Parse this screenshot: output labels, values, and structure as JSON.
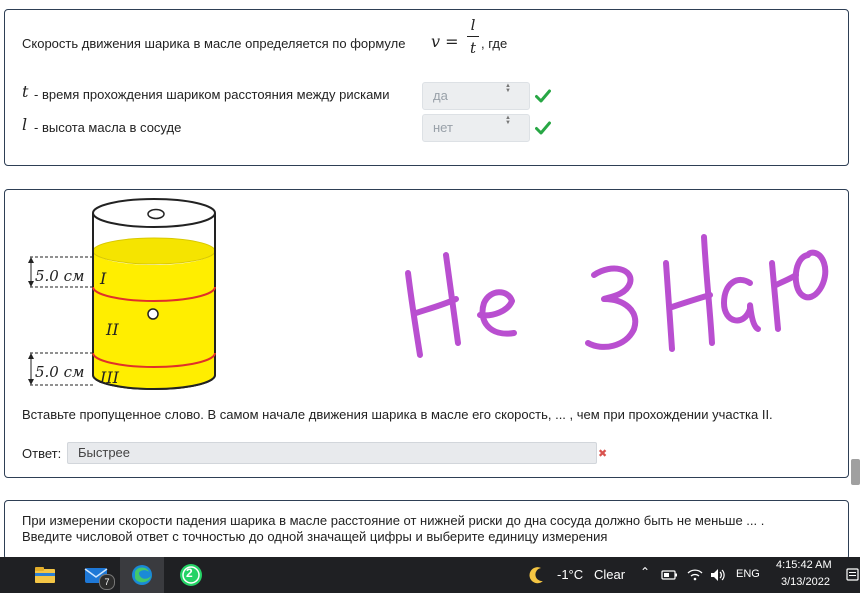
{
  "q1": {
    "intro": "Скорость движения шарика в масле определяется по формуле",
    "formula_lhs": "v =",
    "formula_num": "l",
    "formula_den": "t",
    "intro_end": ", где",
    "rows": [
      {
        "symbol": "t",
        "label": "- время прохождения шариком расстояния между рисками",
        "select_value": "да",
        "status": "correct"
      },
      {
        "symbol": "l",
        "label": "- высота масла в сосуде",
        "select_value": "нет",
        "status": "correct"
      }
    ]
  },
  "q2": {
    "figure": {
      "dimension_top": "5.0 см",
      "dimension_bottom": "5.0 см",
      "section_labels": [
        "I",
        "II",
        "III"
      ]
    },
    "handwritten_note": "Не Знаю",
    "question": "Вставьте пропущенное слово. В самом начале движения шарика в масле его скорость, ... , чем при прохождении участка II.",
    "answer_label": "Ответ:",
    "answer_value": "Быстрее",
    "answer_status": "incorrect"
  },
  "q3": {
    "line1": "При измерении скорости падения шарика в масле расстояние от нижней риски до дна сосуда должно быть не меньше ... .",
    "line2": "Введите числовой ответ с точностью до одной значащей цифры и выберите единицу измерения"
  },
  "taskbar": {
    "mail_badge": "7",
    "whatsapp_badge": "2",
    "weather_temp": "-1°C",
    "weather_text": "Clear",
    "language": "ENG",
    "time": "4:15:42 AM",
    "date": "3/13/2022"
  },
  "colors": {
    "card_border": "#2e3f55",
    "check_green": "#28a745",
    "error_red": "#d9534f",
    "oil_yellow": "#ffee00",
    "handwriting_purple": "#b94fd0",
    "taskbar_bg": "#1f2023"
  }
}
